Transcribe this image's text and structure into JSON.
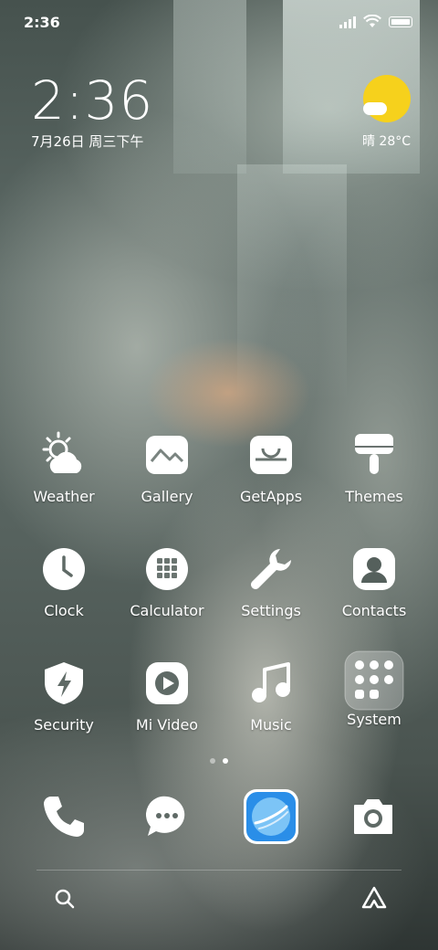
{
  "status_bar": {
    "time": "2:36"
  },
  "clock_widget": {
    "time": "2:36",
    "date": "7月26日 周三下午"
  },
  "weather_widget": {
    "condition": "晴",
    "temperature": "28°C",
    "icon": "sun-icon",
    "sun_color": "#f6d11c"
  },
  "apps": [
    {
      "label": "Weather",
      "icon": "weather-icon"
    },
    {
      "label": "Gallery",
      "icon": "gallery-icon"
    },
    {
      "label": "GetApps",
      "icon": "getapps-icon"
    },
    {
      "label": "Themes",
      "icon": "themes-icon"
    },
    {
      "label": "Clock",
      "icon": "clock-icon"
    },
    {
      "label": "Calculator",
      "icon": "calculator-icon"
    },
    {
      "label": "Settings",
      "icon": "settings-icon"
    },
    {
      "label": "Contacts",
      "icon": "contacts-icon"
    },
    {
      "label": "Security",
      "icon": "security-icon"
    },
    {
      "label": "Mi Video",
      "icon": "mi-video-icon"
    },
    {
      "label": "Music",
      "icon": "music-icon"
    },
    {
      "label": "System",
      "icon": "system-folder-icon"
    }
  ],
  "page_indicator": {
    "pages": 2,
    "active": 2
  },
  "dock": [
    {
      "icon": "phone-icon"
    },
    {
      "icon": "messages-icon"
    },
    {
      "icon": "browser-icon",
      "accent": "#2a8ee8"
    },
    {
      "icon": "camera-icon"
    }
  ],
  "bottom_bar": [
    {
      "icon": "search-icon"
    },
    {
      "icon": "assistant-icon"
    }
  ]
}
